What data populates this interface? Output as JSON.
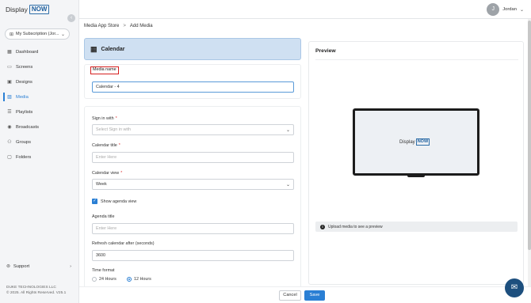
{
  "brand": {
    "name": "Display",
    "badge": "NOW"
  },
  "sidebar": {
    "subscription": "My Subscription (Jor...",
    "items": [
      {
        "label": "Dashboard",
        "icon": "dashboard-icon"
      },
      {
        "label": "Screens",
        "icon": "screens-icon"
      },
      {
        "label": "Designs",
        "icon": "designs-icon"
      },
      {
        "label": "Media",
        "icon": "media-icon",
        "active": true
      },
      {
        "label": "Playlists",
        "icon": "playlists-icon"
      },
      {
        "label": "Broadcasts",
        "icon": "broadcasts-icon"
      },
      {
        "label": "Groups",
        "icon": "groups-icon"
      },
      {
        "label": "Folders",
        "icon": "folders-icon"
      }
    ],
    "support": "Support",
    "footer": {
      "company": "DUKE TECHNOLOGIES LLC",
      "copyright": "© 2025. All Rights Reserved. V25.1"
    }
  },
  "user": {
    "initial": "J",
    "name": "Jordan"
  },
  "breadcrumb": {
    "parent": "Media App Store",
    "separator": ">",
    "current": "Add Media"
  },
  "form": {
    "header": "Calendar",
    "media_name": {
      "label": "Media name",
      "value": "Calendar - 4"
    },
    "sign_in": {
      "label": "Sign in with",
      "placeholder": "Select Sign in with"
    },
    "calendar_title": {
      "label": "Calendar title",
      "placeholder": "Enter Here"
    },
    "calendar_view": {
      "label": "Calendar view",
      "value": "Week"
    },
    "show_agenda": {
      "label": "Show agenda view",
      "checked": true
    },
    "agenda_title": {
      "label": "Agenda title",
      "placeholder": "Enter Here"
    },
    "refresh": {
      "label": "Refresh calendar after (seconds)",
      "value": "3600"
    },
    "time_format": {
      "label": "Time format",
      "options": [
        "24 Hours",
        "12 Hours"
      ],
      "selected": "12 Hours"
    }
  },
  "preview": {
    "title": "Preview",
    "note": "Upload media to see a preview"
  },
  "actions": {
    "cancel": "Cancel",
    "save": "Save"
  },
  "colors": {
    "accent": "#2a7fd4",
    "header_card": "#cfe0f2",
    "highlight": "#d51e1e",
    "chat": "#1d4f7e"
  }
}
